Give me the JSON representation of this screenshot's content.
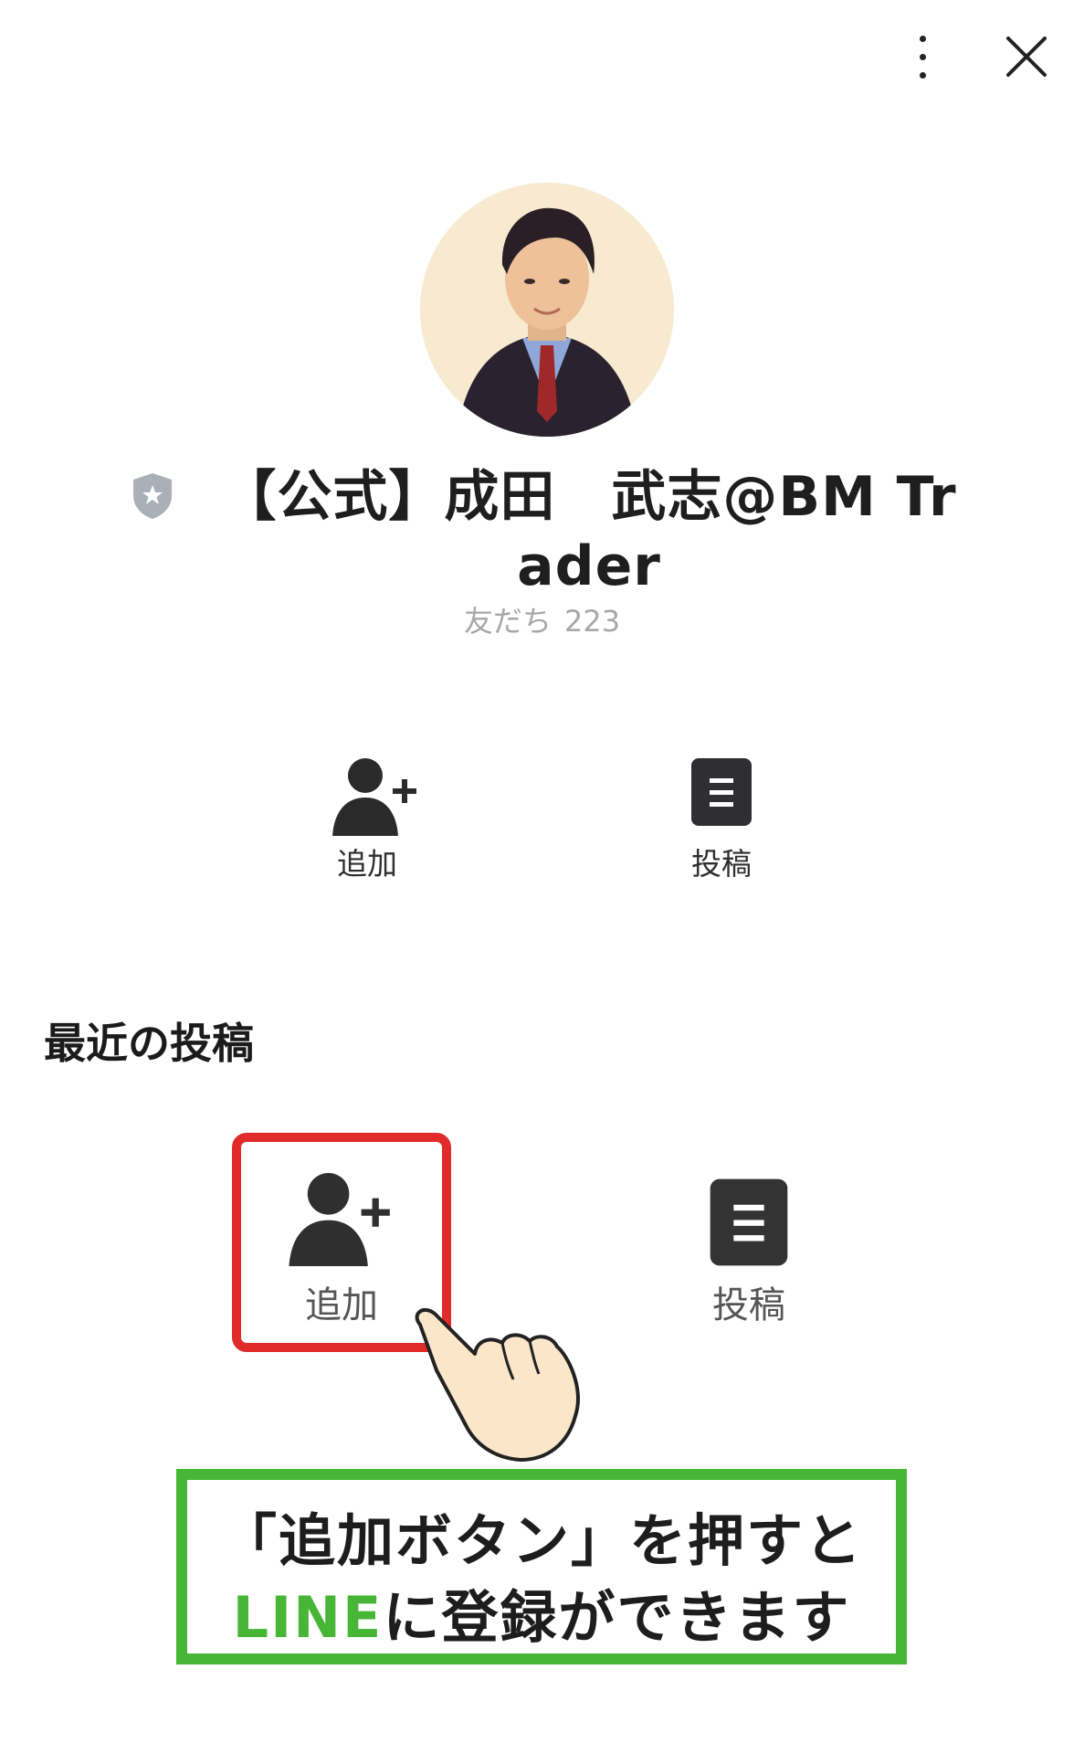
{
  "header": {
    "more_icon": "more-vertical-icon",
    "close_icon": "close-icon"
  },
  "profile": {
    "avatar_description": "portrait",
    "verified_icon": "shield-star-icon",
    "name": "【公式】成田　武志@BM Trader",
    "friends_label": "友だち",
    "friends_count": "223"
  },
  "actions": {
    "add_label": "追加",
    "add_icon": "add-friend-icon",
    "posts_label": "投稿",
    "posts_icon": "document-icon"
  },
  "recent": {
    "title": "最近の投稿"
  },
  "banner": {
    "add_label": "追加",
    "posts_label": "投稿",
    "line1": "「追加ボタン」を押すと",
    "line2_brand": "LINE",
    "line2_rest": "に登録ができます",
    "colors": {
      "highlight_frame": "#e12b2b",
      "brand_green": "#47b536"
    }
  }
}
